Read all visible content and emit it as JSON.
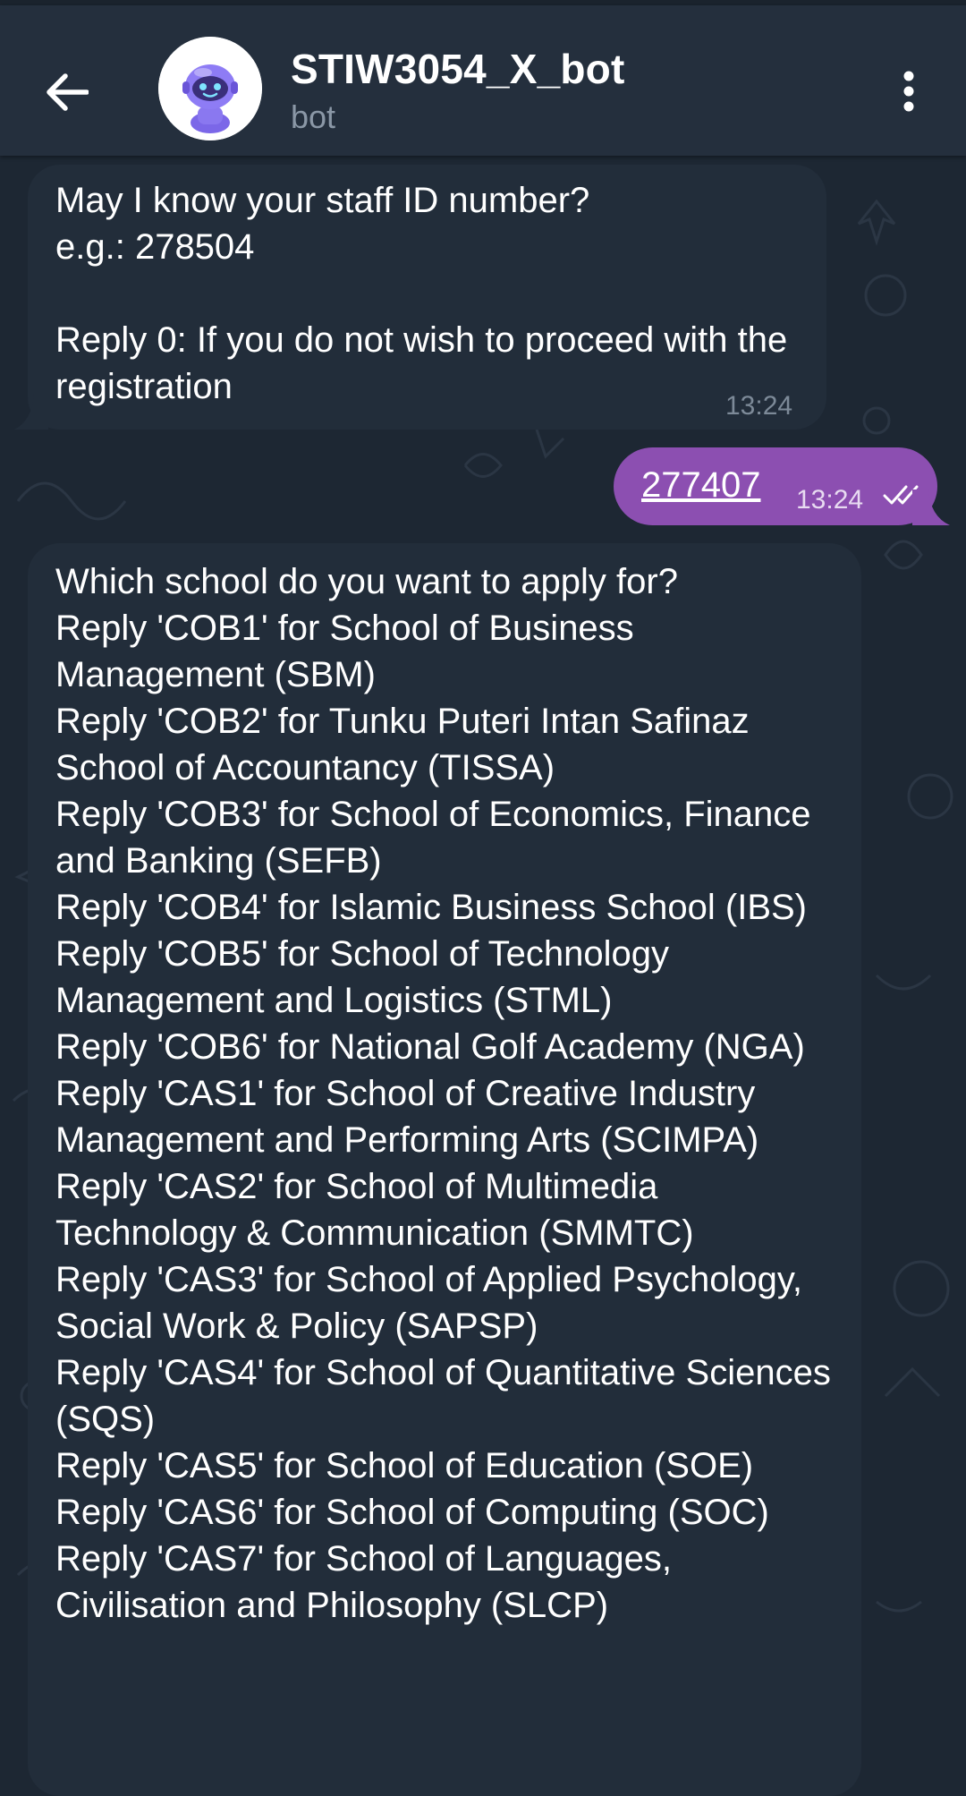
{
  "header": {
    "title": "STIW3054_X_bot",
    "subtitle": "bot"
  },
  "icons": {
    "back": "arrow-left-icon",
    "menu": "more-vertical-icon",
    "avatar": "robot-avatar",
    "read_status": "double-check-icon"
  },
  "colors": {
    "background": "#1d2733",
    "header": "#242f3d",
    "incoming_bubble": "#222d3a",
    "outgoing_bubble": "#8c4fb1"
  },
  "messages": [
    {
      "direction": "incoming",
      "text": "May I know your staff ID number?\ne.g.: 278504\n\nReply 0: If you do not wish to proceed with the registration",
      "time": "13:24"
    },
    {
      "direction": "outgoing",
      "text": "277407",
      "time": "13:24"
    },
    {
      "direction": "incoming",
      "text": "Which school do you want to apply for?\nReply 'COB1' for School of Business Management (SBM)\nReply 'COB2' for Tunku Puteri Intan Safinaz School of Accountancy (TISSA)\nReply 'COB3' for School of Economics, Finance and Banking (SEFB)\nReply 'COB4' for Islamic Business School (IBS)\nReply 'COB5' for School of Technology Management and Logistics (STML)\nReply 'COB6' for National Golf Academy (NGA)\nReply 'CAS1' for School of Creative Industry Management and Performing Arts (SCIMPA)\nReply 'CAS2' for School of Multimedia Technology & Communication (SMMTC)\nReply 'CAS3' for School of Applied Psychology, Social Work & Policy (SAPSP)\nReply 'CAS4' for School of Quantitative Sciences (SQS)\nReply 'CAS5' for School of Education (SOE)\nReply 'CAS6' for School of Computing (SOC)\nReply 'CAS7' for School of Languages, Civilisation and Philosophy (SLCP)"
    }
  ]
}
